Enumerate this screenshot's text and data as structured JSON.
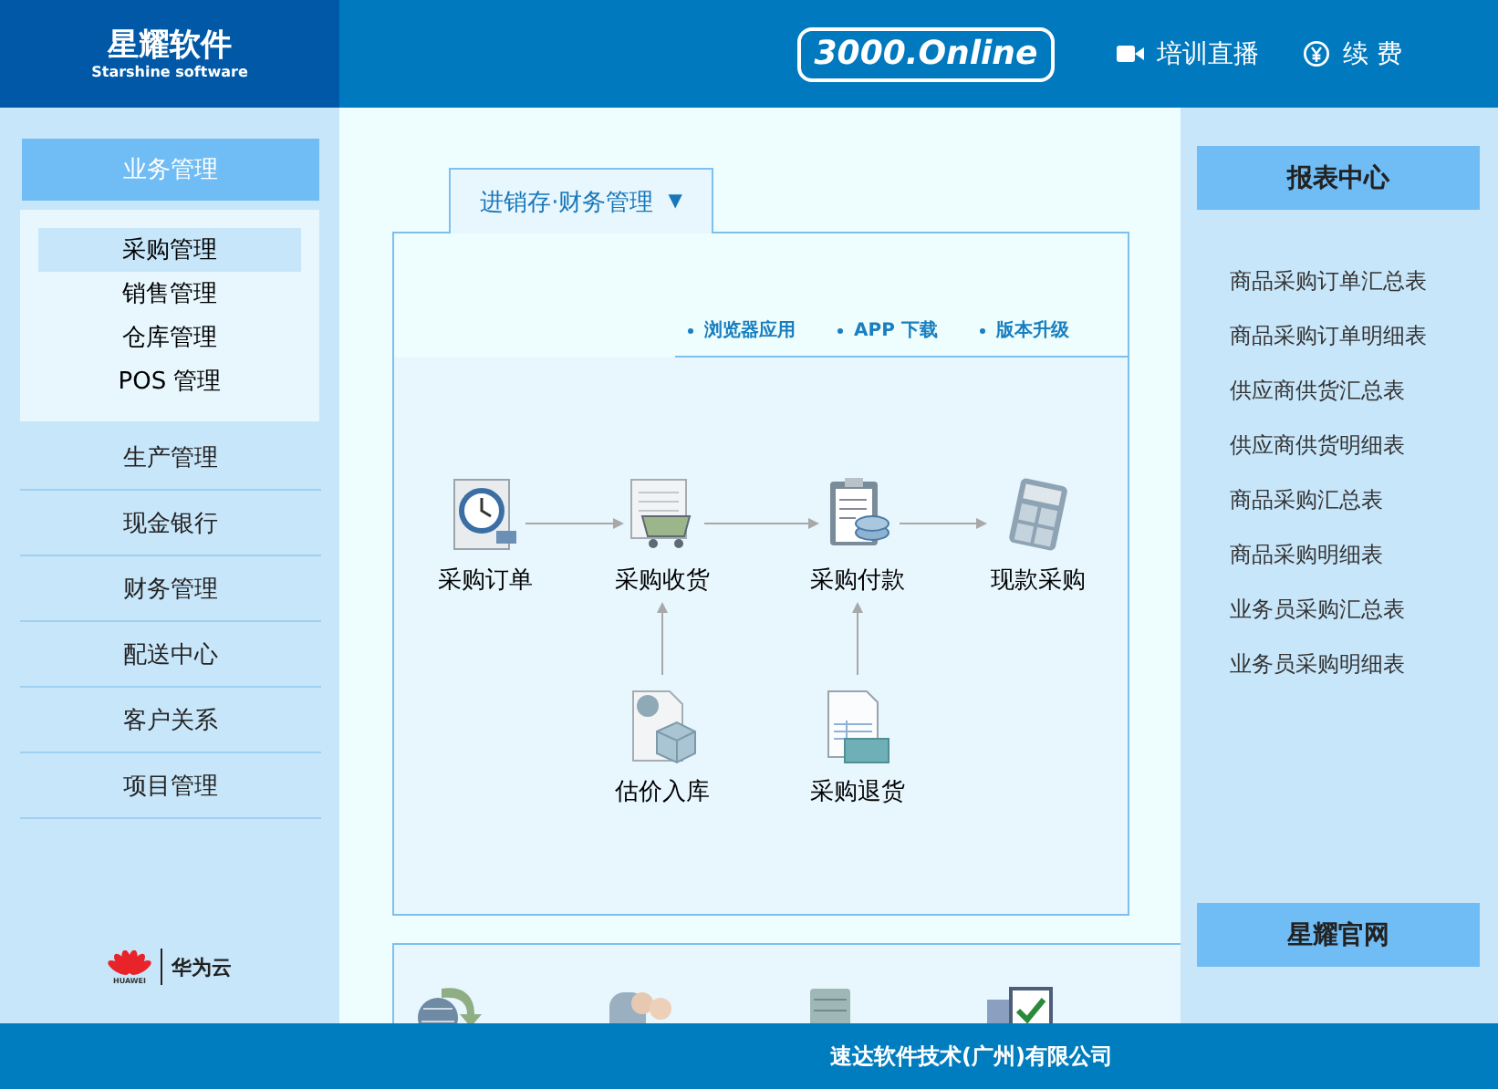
{
  "header": {
    "logo": {
      "name": "星耀软件",
      "tagline": "Starshine software"
    },
    "edition": "3000.Online",
    "actions": [
      {
        "kind": "video",
        "label": "培训直播"
      },
      {
        "kind": "renew",
        "label": "续 费"
      }
    ]
  },
  "sidebar": {
    "groups": [
      {
        "label": "业务管理",
        "expanded": true,
        "children": [
          {
            "label": "采购管理",
            "selected": true
          },
          {
            "label": "销售管理",
            "selected": false
          },
          {
            "label": "仓库管理",
            "selected": false
          },
          {
            "label": "POS 管理",
            "selected": false
          }
        ]
      },
      {
        "label": "生产管理",
        "expanded": false
      },
      {
        "label": "现金银行",
        "expanded": false
      },
      {
        "label": "财务管理",
        "expanded": false
      },
      {
        "label": "配送中心",
        "expanded": false
      },
      {
        "label": "客户关系",
        "expanded": false
      },
      {
        "label": "项目管理",
        "expanded": false
      }
    ],
    "partner": {
      "logo_text": "HUAWEI",
      "name": "华为云"
    }
  },
  "module_tab": {
    "label": "进销存·财务管理",
    "caret": "▼"
  },
  "links": [
    "浏览器应用",
    "APP 下载",
    "版本升级"
  ],
  "flow": {
    "nodes": [
      {
        "kind": "order",
        "label": "采购订单"
      },
      {
        "kind": "receive",
        "label": "采购收货"
      },
      {
        "kind": "pay",
        "label": "采购付款"
      },
      {
        "kind": "cash",
        "label": "现款采购"
      },
      {
        "kind": "estimate",
        "label": "估价入库"
      },
      {
        "kind": "return",
        "label": "采购退货"
      }
    ]
  },
  "shortcut_icons": [
    {
      "kind": "globe"
    },
    {
      "kind": "people"
    },
    {
      "kind": "server"
    },
    {
      "kind": "checklist"
    }
  ],
  "reports": {
    "title": "报表中心",
    "items": [
      "商品采购订单汇总表",
      "商品采购订单明细表",
      "供应商供货汇总表",
      "供应商供货明细表",
      "商品采购汇总表",
      "商品采购明细表",
      "业务员采购汇总表",
      "业务员采购明细表"
    ]
  },
  "website_button": "星耀官网",
  "footer": "速达软件技术(广州)有限公司"
}
